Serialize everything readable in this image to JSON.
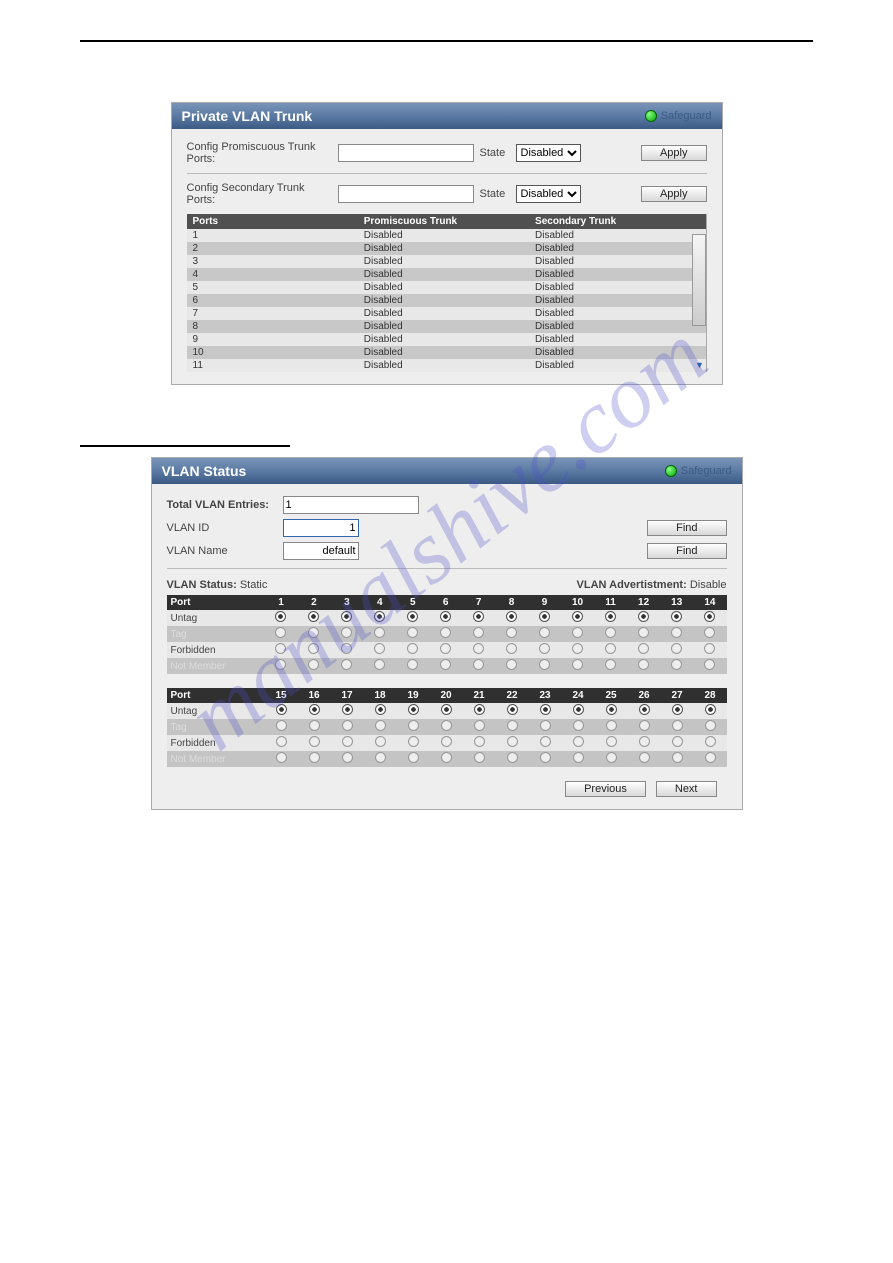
{
  "watermark": "manualshive.com",
  "panel1": {
    "title": "Private VLAN Trunk",
    "safeguard": "Safeguard",
    "row1_label": "Config Promiscuous Trunk Ports:",
    "row2_label": "Config Secondary Trunk Ports:",
    "state_label": "State",
    "state_options": [
      "Disabled"
    ],
    "apply": "Apply",
    "headers": [
      "Ports",
      "Promiscuous Trunk",
      "Secondary Trunk"
    ],
    "rows": [
      {
        "p": "1",
        "pt": "Disabled",
        "st": "Disabled"
      },
      {
        "p": "2",
        "pt": "Disabled",
        "st": "Disabled"
      },
      {
        "p": "3",
        "pt": "Disabled",
        "st": "Disabled"
      },
      {
        "p": "4",
        "pt": "Disabled",
        "st": "Disabled"
      },
      {
        "p": "5",
        "pt": "Disabled",
        "st": "Disabled"
      },
      {
        "p": "6",
        "pt": "Disabled",
        "st": "Disabled"
      },
      {
        "p": "7",
        "pt": "Disabled",
        "st": "Disabled"
      },
      {
        "p": "8",
        "pt": "Disabled",
        "st": "Disabled"
      },
      {
        "p": "9",
        "pt": "Disabled",
        "st": "Disabled"
      },
      {
        "p": "10",
        "pt": "Disabled",
        "st": "Disabled"
      },
      {
        "p": "11",
        "pt": "Disabled",
        "st": "Disabled"
      }
    ]
  },
  "panel2": {
    "title": "VLAN Status",
    "safeguard": "Safeguard",
    "total_label": "Total VLAN Entries:",
    "total_value": "1",
    "vlanid_label": "VLAN ID",
    "vlanid_value": "1",
    "vlanname_label": "VLAN Name",
    "vlanname_value": "default",
    "find": "Find",
    "status_label": "VLAN Status:",
    "status_value": "Static",
    "advert_label": "VLAN Advertistment:",
    "advert_value": "Disable",
    "row_labels": [
      "Untag",
      "Tag",
      "Forbidden",
      "Not Member"
    ],
    "port_header": "Port",
    "ports_a": [
      "1",
      "2",
      "3",
      "4",
      "5",
      "6",
      "7",
      "8",
      "9",
      "10",
      "11",
      "12",
      "13",
      "14"
    ],
    "ports_b": [
      "15",
      "16",
      "17",
      "18",
      "19",
      "20",
      "21",
      "22",
      "23",
      "24",
      "25",
      "26",
      "27",
      "28"
    ],
    "prev": "Previous",
    "next": "Next"
  }
}
